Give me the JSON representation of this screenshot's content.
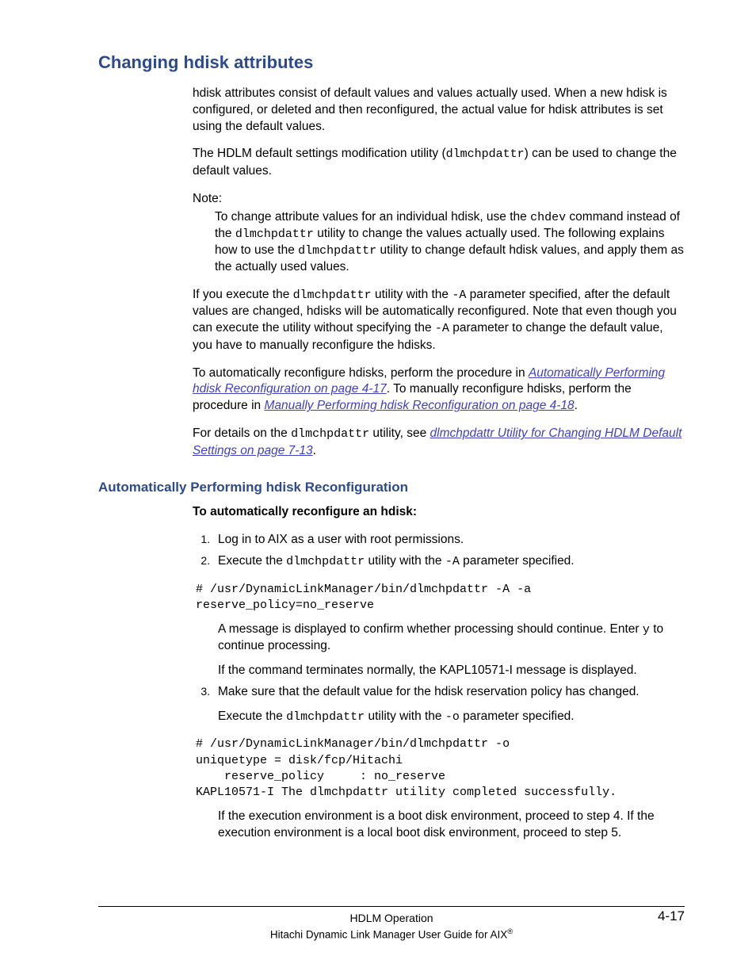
{
  "heading": "Changing hdisk attributes",
  "p1": "hdisk attributes consist of default values and values actually used. When a new hdisk is configured, or deleted and then reconfigured, the actual value for hdisk attributes is set using the default values.",
  "p2_a": "The HDLM default settings modification utility (",
  "p2_code": "dlmchpdattr",
  "p2_b": ") can be used to change the default values.",
  "note_label": "Note:",
  "note_a": "To change attribute values for an individual hdisk, use the ",
  "note_code1": "chdev",
  "note_b": " command instead of the ",
  "note_code2": "dlmchpdattr",
  "note_c": " utility to change the values actually used. The following explains how to use the ",
  "note_code3": "dlmchpdattr",
  "note_d": " utility to change default hdisk values, and apply them as the actually used values.",
  "p3_a": "If you execute the ",
  "p3_code1": "dlmchpdattr",
  "p3_b": " utility with the ",
  "p3_code2": "-A",
  "p3_c": " parameter specified, after the default values are changed, hdisks will be automatically reconfigured. Note that even though you can execute the utility without specifying the ",
  "p3_code3": "-A",
  "p3_d": " parameter to change the default value, you have to manually reconfigure the hdisks.",
  "p4_a": "To automatically reconfigure hdisks, perform the procedure in ",
  "link1": "Automatically Performing hdisk Reconfiguration on page 4-17",
  "p4_b": ". To manually reconfigure hdisks, perform the procedure in ",
  "link2": "Manually Performing hdisk Reconfiguration on page 4-18",
  "p4_c": ".",
  "p5_a": "For details on the ",
  "p5_code": "dlmchpdattr",
  "p5_b": " utility, see ",
  "link3": "dlmchpdattr Utility for Changing HDLM Default Settings on page 7-13",
  "p5_c": ".",
  "subheading": "Automatically Performing hdisk Reconfiguration",
  "proc_title": "To automatically reconfigure an hdisk:",
  "step1": "Log in to AIX as a user with root permissions.",
  "step2_a": "Execute the ",
  "step2_code1": "dlmchpdattr",
  "step2_b": " utility with the ",
  "step2_code2": "-A",
  "step2_c": " parameter specified.",
  "code1": "# /usr/DynamicLinkManager/bin/dlmchpdattr -A -a\nreserve_policy=no_reserve",
  "step2_p2_a": "A message is displayed to confirm whether processing should continue. Enter ",
  "step2_p2_code": "y",
  "step2_p2_b": " to continue processing.",
  "step2_p3": "If the command terminates normally, the KAPL10571-I message is displayed.",
  "step3_a": "Make sure that the default value for the hdisk reservation policy has changed.",
  "step3_p2_a": "Execute the ",
  "step3_p2_code1": "dlmchpdattr",
  "step3_p2_b": " utility with the ",
  "step3_p2_code2": "-o",
  "step3_p2_c": " parameter specified.",
  "code2": "# /usr/DynamicLinkManager/bin/dlmchpdattr -o\nuniquetype = disk/fcp/Hitachi\n    reserve_policy     : no_reserve\nKAPL10571-I The dlmchpdattr utility completed successfully.",
  "step3_p3": "If the execution environment is a boot disk environment, proceed to step 4. If the execution environment is a local boot disk environment, proceed to step 5.",
  "footer_title": "HDLM Operation",
  "footer_page": "4-17",
  "footer_sub_a": "Hitachi Dynamic Link Manager User Guide for AIX",
  "footer_sub_reg": "®"
}
